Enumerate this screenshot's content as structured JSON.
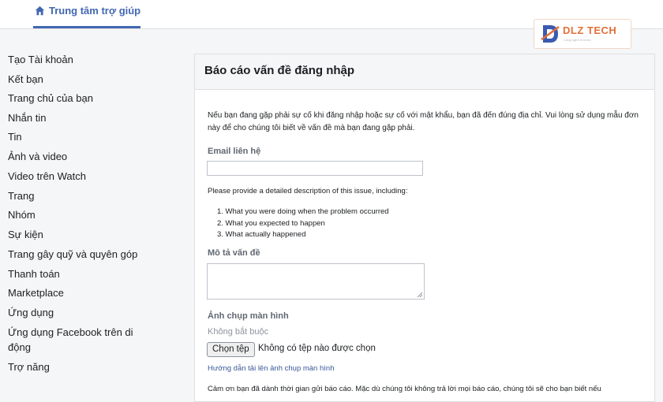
{
  "header": {
    "help_center_label": "Trung tâm trợ giúp"
  },
  "logo": {
    "brand": "DLZ TECH",
    "tagline": "Công nghệ đi trước"
  },
  "sidebar": {
    "items": [
      {
        "label": "Tạo Tài khoản"
      },
      {
        "label": "Kết bạn"
      },
      {
        "label": "Trang chủ của bạn"
      },
      {
        "label": "Nhắn tin"
      },
      {
        "label": "Tin"
      },
      {
        "label": "Ảnh và video"
      },
      {
        "label": "Video trên Watch"
      },
      {
        "label": "Trang"
      },
      {
        "label": "Nhóm"
      },
      {
        "label": "Sự kiện"
      },
      {
        "label": "Trang gây quỹ và quyên góp"
      },
      {
        "label": "Thanh toán"
      },
      {
        "label": "Marketplace"
      },
      {
        "label": "Ứng dụng"
      },
      {
        "label": "Ứng dụng Facebook trên di động"
      },
      {
        "label": "Trợ năng"
      }
    ]
  },
  "form": {
    "title": "Báo cáo vấn đề đăng nhập",
    "intro": "Nếu bạn đang gặp phải sự cố khi đăng nhập hoặc sự cố với mật khẩu, bạn đã đến đúng địa chỉ. Vui lòng sử dụng mẫu đơn này để cho chúng tôi biết về vấn đề mà bạn đang gặp phải.",
    "email_label": "Email liên hệ",
    "email_value": "",
    "provide_text": "Please provide a detailed description of this issue, including:",
    "steps": [
      "1. What you were doing when the problem occurred",
      "2. What you expected to happen",
      "3. What actually happened"
    ],
    "description_label": "Mô tả vấn đề",
    "screenshot_label": "Ảnh chụp màn hình",
    "optional_label": "Không bắt buộc",
    "choose_file_label": "Chọn tệp",
    "no_file_text": "Không có tệp nào được chọn",
    "guide_link": "Hướng dẫn tải lên ảnh chụp màn hình",
    "thanks_text": "Cảm ơn bạn đã dành thời gian gửi báo cáo. Mặc dù chúng tôi không trả lời mọi báo cáo, chúng tôi sẽ cho bạn biết nếu"
  },
  "colors": {
    "accent": "#4267b2",
    "link": "#385898",
    "logo": "#e2703a"
  }
}
